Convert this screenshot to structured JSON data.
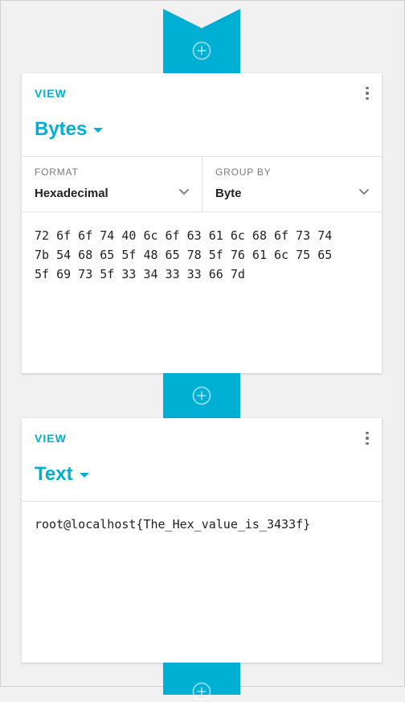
{
  "bytes_view": {
    "section_label": "VIEW",
    "title": "Bytes",
    "format": {
      "label": "FORMAT",
      "value": "Hexadecimal"
    },
    "group_by": {
      "label": "GROUP BY",
      "value": "Byte"
    },
    "hex_lines": [
      "72 6f 6f 74 40 6c 6f 63 61 6c 68 6f 73 74",
      "7b 54 68 65 5f 48 65 78 5f 76 61 6c 75 65",
      "5f 69 73 5f 33 34 33 33 66 7d"
    ]
  },
  "text_view": {
    "section_label": "VIEW",
    "title": "Text",
    "content": "root@localhost{The_Hex_value_is_3433f}"
  },
  "colors": {
    "accent": "#00b0d4",
    "background": "#f1f1f1",
    "card": "#ffffff",
    "text": "#222222",
    "muted": "#7a7a7a"
  },
  "icons": {
    "add": "add-circle-icon",
    "more": "more-vert-icon",
    "dropdown": "arrow-drop-down-icon",
    "chevron": "chevron-down-icon"
  }
}
